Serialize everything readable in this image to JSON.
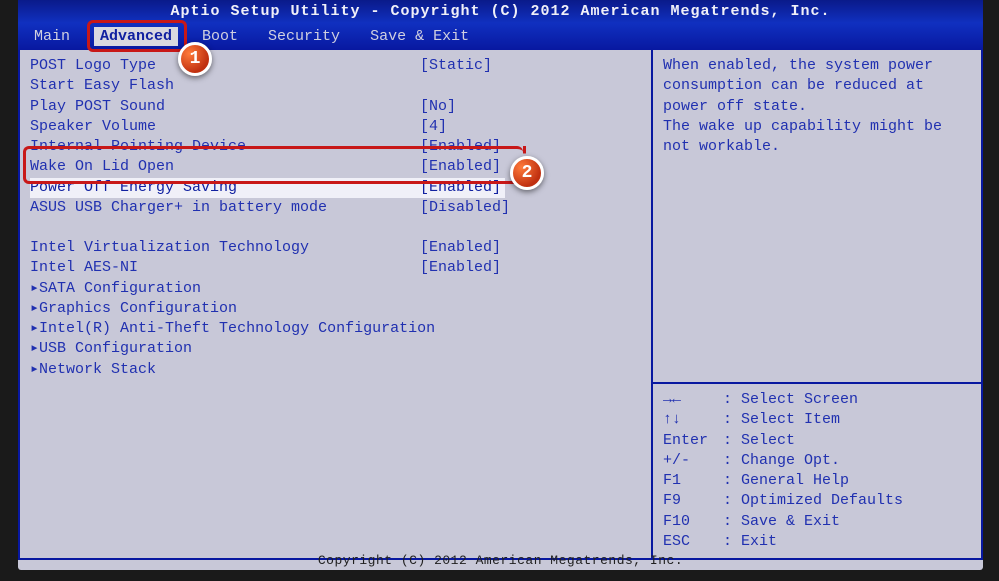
{
  "header": {
    "title": "Aptio Setup Utility - Copyright (C) 2012 American Megatrends, Inc."
  },
  "footer": {
    "text": "Copyright (C) 2012 American Megatrends, Inc."
  },
  "tabs": {
    "main": "Main",
    "advanced": "Advanced",
    "boot": "Boot",
    "security": "Security",
    "save_exit": "Save & Exit"
  },
  "settings": {
    "post_logo": {
      "label": "POST Logo Type",
      "value": "[Static]"
    },
    "easy_flash": {
      "label": "Start Easy Flash",
      "value": ""
    },
    "play_post_sound": {
      "label": "Play POST Sound",
      "value": "[No]"
    },
    "speaker_volume": {
      "label": "Speaker Volume",
      "value": "[4]"
    },
    "internal_pointing": {
      "label": "Internal Pointing Device",
      "value": "[Enabled]"
    },
    "wake_on_lid": {
      "label": "Wake On Lid Open",
      "value": "[Enabled]"
    },
    "power_off_energy": {
      "label": "Power Off Energy Saving",
      "value": "[Enabled]"
    },
    "usb_charger": {
      "label": "ASUS USB Charger+ in battery mode",
      "value": "[Disabled]"
    },
    "intel_vt": {
      "label": "Intel Virtualization Technology",
      "value": "[Enabled]"
    },
    "intel_aesni": {
      "label": "Intel AES-NI",
      "value": "[Enabled]"
    },
    "sata_config": {
      "label": "SATA Configuration"
    },
    "gfx_config": {
      "label": "Graphics Configuration"
    },
    "anti_theft": {
      "label": "Intel(R) Anti-Theft Technology Configuration"
    },
    "usb_config": {
      "label": "USB Configuration"
    },
    "network_stack": {
      "label": "Network Stack"
    }
  },
  "help": {
    "text": "When enabled, the system power consumption can be reduced at power off state.\nThe wake up capability might be not workable."
  },
  "keys": {
    "screen": {
      "k": "→←",
      "d": ": Select Screen"
    },
    "item": {
      "k": "↑↓",
      "d": ": Select Item"
    },
    "enter": {
      "k": "Enter",
      "d": ": Select"
    },
    "change": {
      "k": "+/-",
      "d": ": Change Opt."
    },
    "f1": {
      "k": "F1",
      "d": ": General Help"
    },
    "f9": {
      "k": "F9",
      "d": ": Optimized Defaults"
    },
    "f10": {
      "k": "F10",
      "d": ": Save & Exit"
    },
    "esc": {
      "k": "ESC",
      "d": ": Exit"
    }
  },
  "annotations": {
    "badge1": "1",
    "badge2": "2"
  }
}
